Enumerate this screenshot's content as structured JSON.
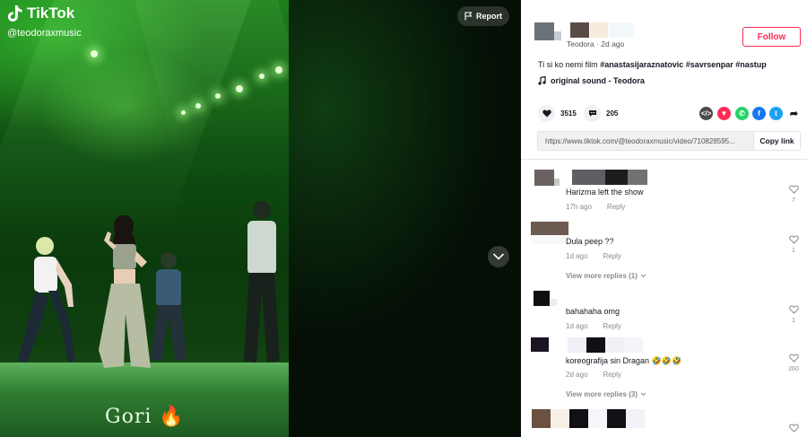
{
  "player": {
    "brand": "TikTok",
    "handle": "@teodoraxmusic",
    "overlay_caption": "Gori 🔥",
    "report_label": "Report",
    "next_icon": "chevron-down-icon"
  },
  "post": {
    "author_meta": "Teodora · 2d ago",
    "follow_label": "Follow",
    "description_plain": "Ti si ko nemi film ",
    "hashtags": "#anastasijaraznatovic #savrsenpar #nastup",
    "sound": "original sound - Teodora",
    "likes": "3515",
    "comments_count": "205",
    "share_link": "https://www.tiktok.com/@teodoraxmusic/video/710828595...",
    "copy_link_label": "Copy link"
  },
  "colors": {
    "accent": "#fe2c55",
    "share_embed": "#4b4b4b",
    "share_red": "#fe2c55",
    "share_whatsapp": "#25d366",
    "share_facebook": "#1877f2",
    "share_twitter": "#1da1f2"
  },
  "comments": [
    {
      "text": "Harizma left the show",
      "time": "17h ago",
      "reply": "Reply",
      "likes": "7"
    },
    {
      "text": "Dula peep ??",
      "time": "1d ago",
      "reply": "Reply",
      "likes": "1",
      "view_more": "View more replies (1)"
    },
    {
      "text": "bahahaha omg",
      "time": "1d ago",
      "reply": "Reply",
      "likes": "1"
    },
    {
      "text": "koreografija sin Dragan 🤣🤣🤣",
      "time": "2d ago",
      "reply": "Reply",
      "likes": "260",
      "view_more": "View more replies (3)"
    }
  ]
}
